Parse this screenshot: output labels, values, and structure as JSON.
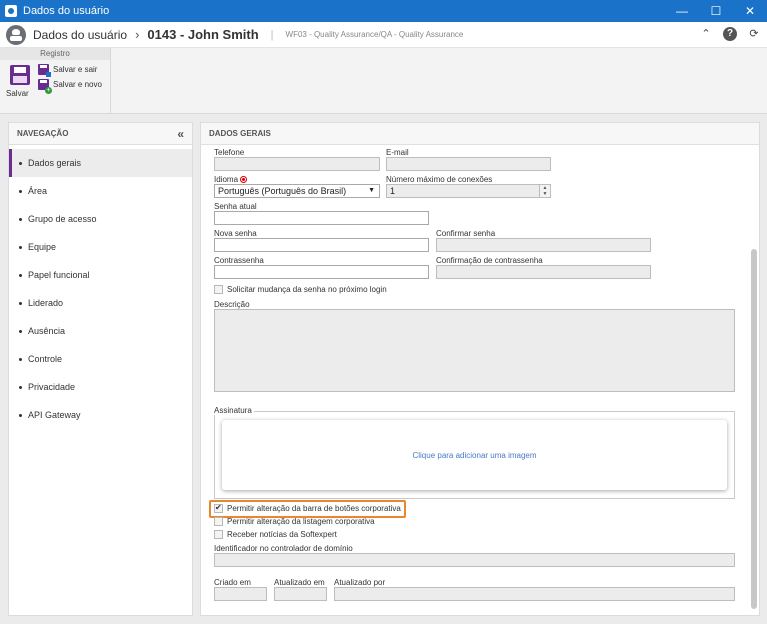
{
  "window": {
    "title": "Dados do usuário",
    "controls": [
      "minimize-icon",
      "maximize-icon",
      "close-icon"
    ]
  },
  "header": {
    "module": "Dados do usuário",
    "record": "0143 - John Smith",
    "workflow": "WF03 - Quality Assurance/QA - Quality Assurance"
  },
  "ribbon": {
    "group_label": "Registro",
    "save_label": "Salvar",
    "save_exit_label": "Salvar e sair",
    "save_new_label": "Salvar e novo"
  },
  "nav": {
    "title": "NAVEGAÇÃO",
    "items": [
      {
        "label": "Dados gerais",
        "active": true
      },
      {
        "label": "Área"
      },
      {
        "label": "Grupo de acesso"
      },
      {
        "label": "Equipe"
      },
      {
        "label": "Papel funcional"
      },
      {
        "label": "Liderado"
      },
      {
        "label": "Ausência"
      },
      {
        "label": "Controle"
      },
      {
        "label": "Privacidade"
      },
      {
        "label": "API Gateway"
      }
    ]
  },
  "form": {
    "section_title": "DADOS GERAIS",
    "telefone_label": "Telefone",
    "telefone_value": "",
    "email_label": "E-mail",
    "email_value": "",
    "idioma_label": "Idioma",
    "idioma_value": "Português (Português do Brasil)",
    "max_conn_label": "Número máximo de conexões",
    "max_conn_value": "1",
    "senha_atual_label": "Senha atual",
    "nova_senha_label": "Nova senha",
    "confirmar_senha_label": "Confirmar senha",
    "contrassenha_label": "Contrassenha",
    "confirm_contrassenha_label": "Confirmação de contrassenha",
    "solicitar_mudanca_label": "Solicitar mudança da senha no próximo login",
    "solicitar_mudanca_checked": false,
    "descricao_label": "Descrição",
    "assinatura_label": "Assinatura",
    "assinatura_action": "Clique para adicionar uma imagem",
    "permitir_barra_label": "Permitir alteração da barra de botões corporativa",
    "permitir_barra_checked": true,
    "permitir_listagem_label": "Permitir alteração da listagem corporativa",
    "permitir_listagem_checked": false,
    "receber_noticias_label": "Receber notícias da Softexpert",
    "receber_noticias_checked": false,
    "identificador_label": "Identificador no controlador de domínio",
    "criado_label": "Criado em",
    "atualizado_label": "Atualizado em",
    "atualizado_por_label": "Atualizado por"
  },
  "colors": {
    "titlebar": "#1a73c8",
    "accent": "#6a2c91",
    "highlight": "#e8872e"
  }
}
